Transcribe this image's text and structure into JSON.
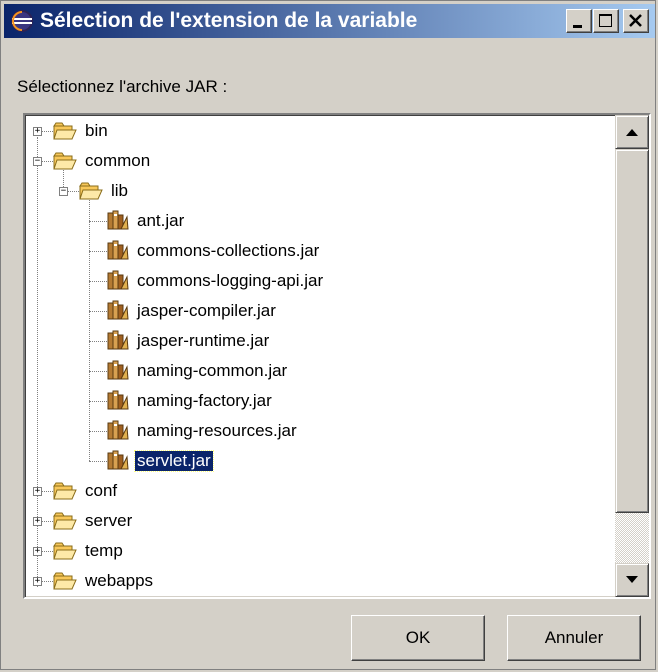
{
  "window": {
    "title": "Sélection de l'extension de la variable",
    "controls": {
      "minimize": "minimize",
      "maximize": "maximize",
      "close": "close"
    }
  },
  "prompt": "Sélectionnez l'archive JAR :",
  "tree": {
    "nodes": [
      {
        "label": "bin",
        "type": "folder",
        "level": 0,
        "expander": "+"
      },
      {
        "label": "common",
        "type": "folder",
        "level": 0,
        "expander": "-"
      },
      {
        "label": "lib",
        "type": "folder",
        "level": 1,
        "expander": "-"
      },
      {
        "label": "ant.jar",
        "type": "jar",
        "level": 2
      },
      {
        "label": "commons-collections.jar",
        "type": "jar",
        "level": 2
      },
      {
        "label": "commons-logging-api.jar",
        "type": "jar",
        "level": 2
      },
      {
        "label": "jasper-compiler.jar",
        "type": "jar",
        "level": 2
      },
      {
        "label": "jasper-runtime.jar",
        "type": "jar",
        "level": 2
      },
      {
        "label": "naming-common.jar",
        "type": "jar",
        "level": 2
      },
      {
        "label": "naming-factory.jar",
        "type": "jar",
        "level": 2
      },
      {
        "label": "naming-resources.jar",
        "type": "jar",
        "level": 2
      },
      {
        "label": "servlet.jar",
        "type": "jar",
        "level": 2,
        "selected": true
      },
      {
        "label": "conf",
        "type": "folder",
        "level": 0,
        "expander": "+"
      },
      {
        "label": "server",
        "type": "folder",
        "level": 0,
        "expander": "+"
      },
      {
        "label": "temp",
        "type": "folder",
        "level": 0,
        "expander": "+"
      },
      {
        "label": "webapps",
        "type": "folder",
        "level": 0,
        "expander": "+"
      }
    ]
  },
  "buttons": {
    "ok": "OK",
    "cancel": "Annuler"
  },
  "colors": {
    "titlebar_start": "#0a246a",
    "titlebar_end": "#a6caf0",
    "selection": "#0a246a",
    "dialog_bg": "#d4d0c8"
  }
}
